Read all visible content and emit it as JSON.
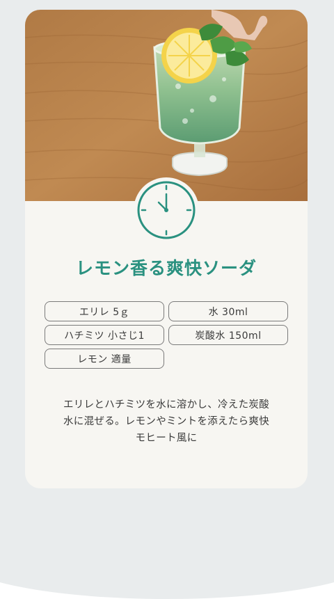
{
  "recipe": {
    "title": "レモン香る爽快ソーダ",
    "photo_alt": "lemon-mint-green-soda-photo",
    "clock_icon": "clock-icon",
    "ingredients": [
      "エリレ 5ｇ",
      "水 30ml",
      "ハチミツ 小さじ1",
      "炭酸水 150ml",
      "レモン 適量"
    ],
    "description_lines": [
      "エリレとハチミツを水に溶かし、冷えた炭酸",
      "水に混ぜる。レモンやミントを添えたら爽快",
      "モヒート風に"
    ]
  },
  "colors": {
    "accent": "#2a9180",
    "card_bg": "#f7f6f2",
    "page_bg": "#e9eced",
    "chip_border": "#7a7a7a"
  }
}
